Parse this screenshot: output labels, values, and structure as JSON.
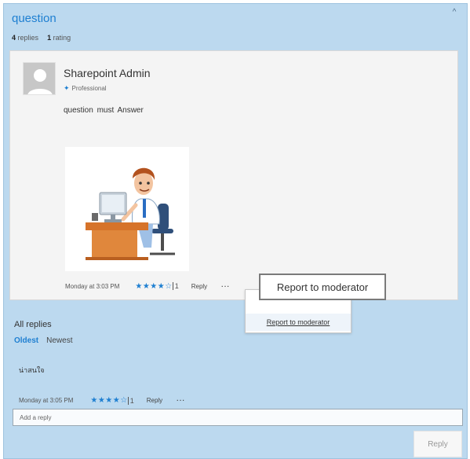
{
  "thread": {
    "title": "question",
    "reply_count": "4",
    "reply_label": "replies",
    "rating_count": "1",
    "rating_label": "rating"
  },
  "post": {
    "author": "Sharepoint Admin",
    "role": "Professional",
    "body": "question must Answer",
    "timestamp": "Monday at 3:03 PM",
    "stars": "★★★★☆",
    "rating_count": "1",
    "reply_label": "Reply",
    "more_label": "···"
  },
  "popup": {
    "tooltip": "Report to moderator",
    "menu_item": "Report to moderator"
  },
  "replies": {
    "heading": "All replies",
    "sort_oldest": "Oldest",
    "sort_newest": "Newest",
    "items": [
      {
        "text": "น่าสนใจ",
        "timestamp": "Monday at 3:05 PM",
        "stars": "★★★★☆",
        "rating_count": "1",
        "reply_label": "Reply",
        "more_label": "···"
      }
    ]
  },
  "composer": {
    "placeholder": "Add a reply",
    "submit_label": "Reply"
  },
  "colors": {
    "panel_bg": "#bcd9ef",
    "accent": "#1e7fd1",
    "card_bg": "#f4f4f4"
  },
  "icons": {
    "collapse": "chevron-up-icon",
    "role": "pin-icon",
    "avatar": "user-placeholder-icon"
  }
}
